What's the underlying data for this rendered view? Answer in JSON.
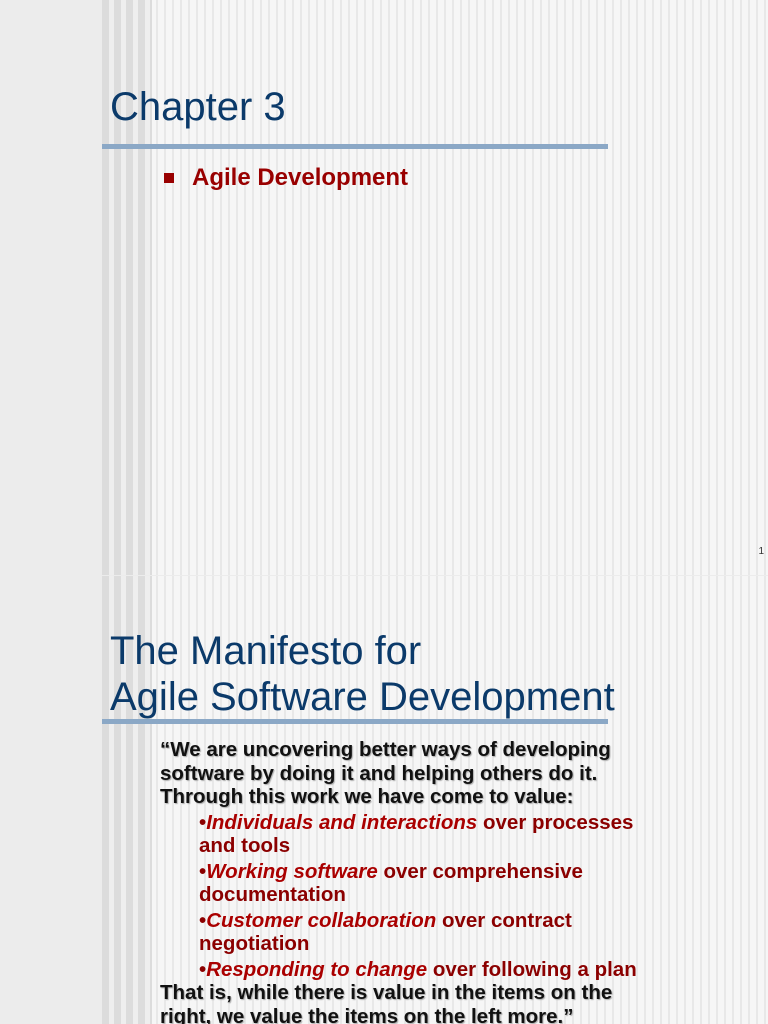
{
  "slide1": {
    "title": "Chapter 3",
    "bullets": [
      "Agile Development"
    ],
    "page_number": "1"
  },
  "slide2": {
    "title_line1": "The Manifesto for",
    "title_line2": "Agile Software Development",
    "intro": "“We are uncovering better ways of developing software by doing it and helping others do it. Through this work we have come to value:",
    "items": [
      {
        "emphasis": "Individuals and interactions",
        "rest": " over processes and tools"
      },
      {
        "emphasis": "Working software",
        "rest": " over comprehensive documentation"
      },
      {
        "emphasis": "Customer collaboration",
        "rest": " over contract negotiation"
      },
      {
        "emphasis": "Responding to change",
        "rest": " over following a plan"
      }
    ],
    "outro": "That is, while there is value in the items on the right, we value the items on the left more.”",
    "bullet_char": "•"
  },
  "colors": {
    "title": "#0b3a6a",
    "accent": "#990000",
    "rule": "#8ba8c6"
  }
}
